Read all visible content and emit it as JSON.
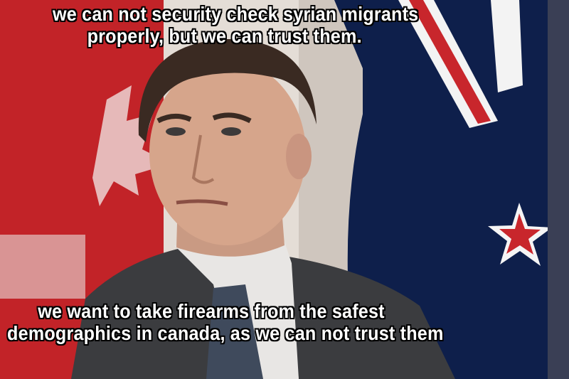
{
  "meme": {
    "top_caption": {
      "line1": "we can not security check syrian migrants",
      "line2": "properly, but we can trust them."
    },
    "bottom_caption": {
      "line1": "we want to take firearms from the safest",
      "line2": "demographics in canada, as we can not trust them"
    },
    "colors": {
      "canada_red": "#c8262c",
      "flag_navy": "#0b1a3e",
      "caption_text": "#ffffff",
      "caption_outline": "#000000"
    }
  }
}
